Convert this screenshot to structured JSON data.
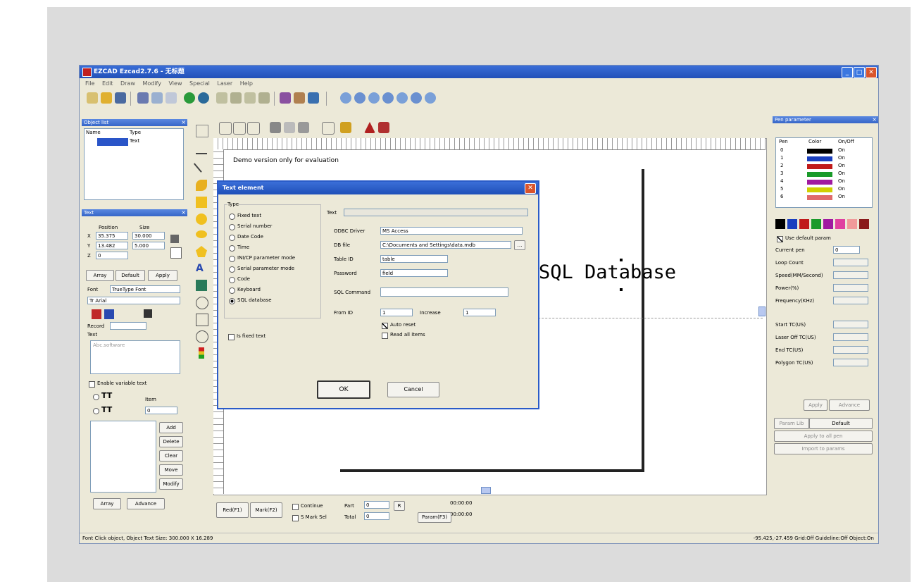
{
  "window": {
    "title": "EZCAD Ezcad2.7.6 - 无标题",
    "minimize": "_",
    "maximize": "□",
    "close": "✕"
  },
  "menu": [
    "File",
    "Edit",
    "Draw",
    "Modify",
    "View",
    "Special",
    "Laser",
    "Help"
  ],
  "object_list": {
    "title": "Object list",
    "col_name": "Name",
    "col_type": "Type",
    "row_type": "Text"
  },
  "object_props": {
    "title": "Text",
    "position_label": "Position",
    "size_label": "Size",
    "x_label": "X",
    "y_label": "Y",
    "z_label": "Z",
    "x_value": "35.375",
    "y_value": "13.482",
    "z_value": "0",
    "w_value": "30.000",
    "h_value": "5.000",
    "apply_btn": "Array",
    "default_btn": "Default",
    "apply2_btn": "Apply"
  },
  "text_section": {
    "font_label": "Font",
    "font_value": "TrueType Font",
    "font_name": "Tr Arial",
    "record_label": "Record",
    "text_label": "Text",
    "text_value": "Abc.software",
    "enable_variable": "Enable variable text",
    "item_label": "Item",
    "item_value": "0",
    "add_btn": "Add",
    "delete_btn": "Delete",
    "clear_btn": "Clear",
    "move_btn": "Move",
    "modify_btn": "Modify",
    "array_btn": "Array",
    "advance_btn": "Advance"
  },
  "canvas": {
    "banner": "Demo version only for evaluation",
    "text": "SQL Database"
  },
  "dialog": {
    "title": "Text element",
    "type_label": "Type",
    "types": [
      "Fixed text",
      "Serial number",
      "Date Code",
      "Time",
      "INI/CP parameter mode",
      "Serial parameter mode",
      "Code",
      "Keyboard",
      "SQL database"
    ],
    "text_label": "Text",
    "odbc_label": "ODBC Driver",
    "odbc_value": "MS Access",
    "file_label": "DB file",
    "file_value": "C:\\Documents and Settings\\data.mdb",
    "table_label": "Table ID",
    "table_value": "table",
    "password_label": "Password",
    "password_value": "field",
    "sql_label": "SQL Command",
    "from_label": "From ID",
    "from_value": "1",
    "increase_label": "Increase",
    "increase_value": "1",
    "auto_reset": "Auto reset",
    "read_all": "Read all items",
    "fixed_text_chk": "Is fixed text",
    "ok_btn": "OK",
    "cancel_btn": "Cancel"
  },
  "right_panel": {
    "title": "Pen parameter",
    "col_pen": "Pen",
    "col_color": "Color",
    "col_onoff": "On/Off",
    "pens": [
      {
        "name": "0",
        "color": "#000000",
        "state": "On"
      },
      {
        "name": "1",
        "color": "#1a3fbf",
        "state": "On"
      },
      {
        "name": "2",
        "color": "#c01a1a",
        "state": "On"
      },
      {
        "name": "3",
        "color": "#1a9a2a",
        "state": "On"
      },
      {
        "name": "4",
        "color": "#a01aa0",
        "state": "On"
      },
      {
        "name": "5",
        "color": "#d0d000",
        "state": "On"
      },
      {
        "name": "6",
        "color": "#e06a6a",
        "state": "On"
      }
    ],
    "palette": [
      "#000000",
      "#1a3fbf",
      "#c01a1a",
      "#1a9a2a",
      "#a01aa0",
      "#e040a0",
      "#f09a9a",
      "#8a1a1a"
    ],
    "use_default": "Use default param",
    "current_pen_label": "Current pen",
    "current_pen": "0",
    "params": [
      "Loop Count",
      "Speed(MM/Second)",
      "Power(%)",
      "Frequency(KHz)",
      "Start TC(US)",
      "Laser Off TC(US)",
      "End TC(US)",
      "Polygon TC(US)"
    ],
    "apply_btn": "Apply",
    "advance_btn": "Advance",
    "param_lib": "Param Lib",
    "default_param": "Default",
    "apply_pen": "Apply to all pen",
    "use_param": "Import to params"
  },
  "bottom_bar": {
    "red_btn": "Red(F1)",
    "mark_btn": "Mark(F2)",
    "continue": "Continue",
    "select_mark": "S Mark Sel",
    "part_label": "Part",
    "part_value": "0",
    "total_label": "Total",
    "total_value": "0",
    "time1": "00:00:00",
    "time2": "00:00:00",
    "param_btn": "Param(F3)"
  },
  "status": {
    "left": "Font Click object, Object Text Size: 300.000 X 16.289",
    "right": "-95.425,-27.459  Grid:Off  Guideline:Off  Object:On"
  }
}
